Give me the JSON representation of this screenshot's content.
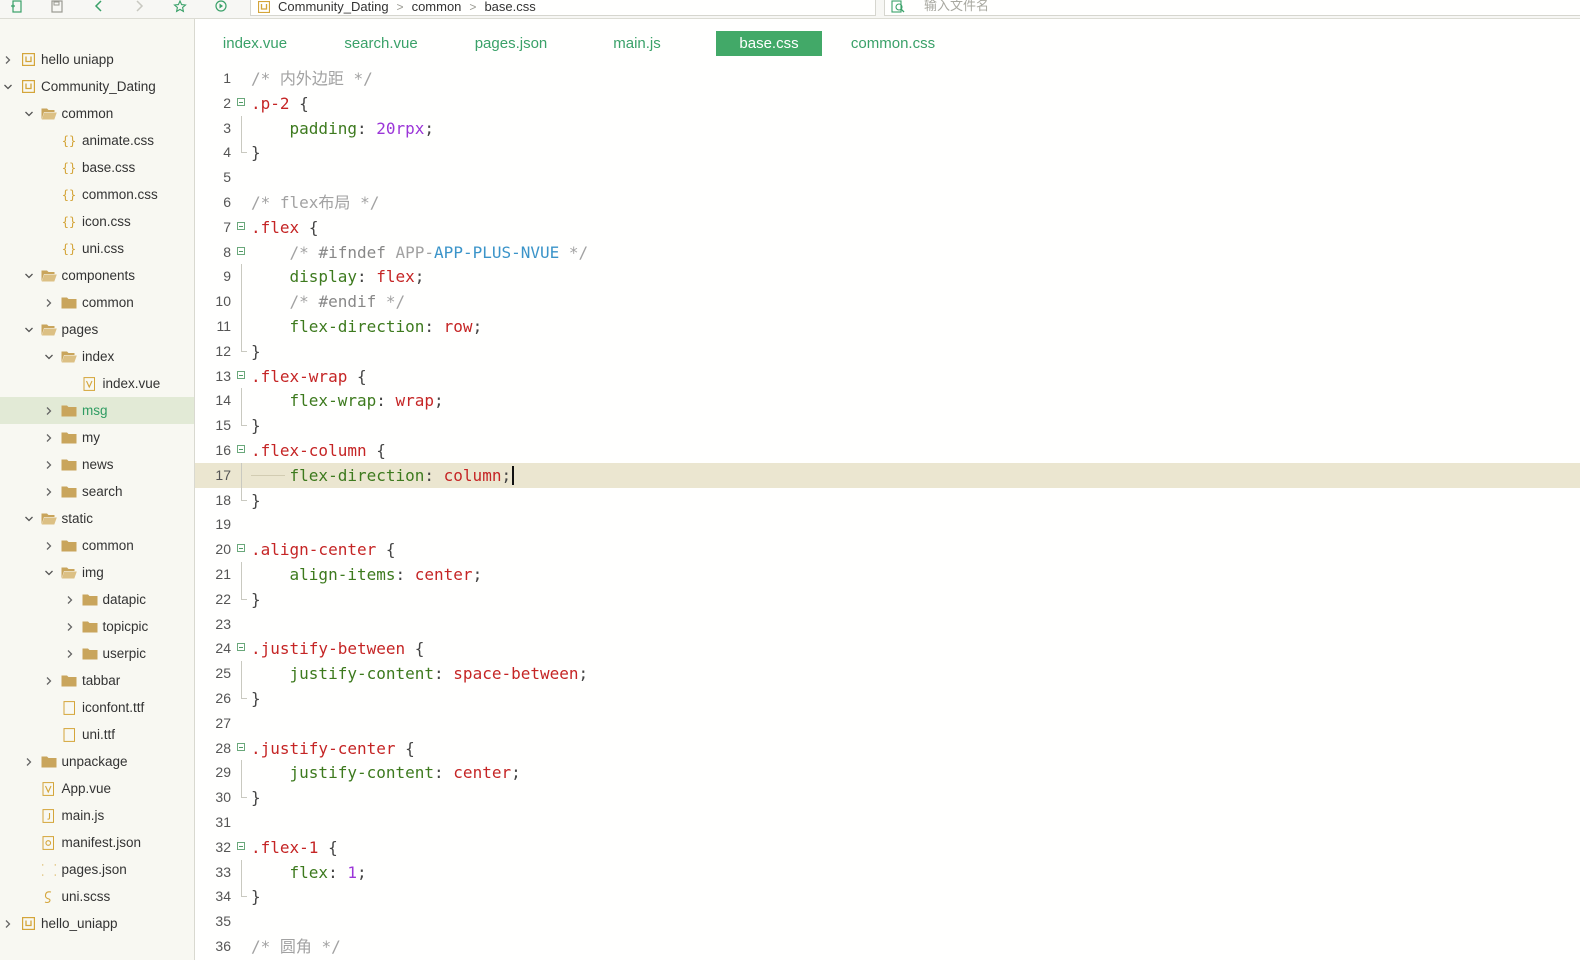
{
  "toolbar": {
    "icons": [
      "new-file-icon",
      "save-icon",
      "back-icon",
      "forward-icon",
      "star-icon",
      "run-icon"
    ]
  },
  "breadcrumb": {
    "items": [
      "Community_Dating",
      "common",
      "base.css"
    ],
    "separator": ">"
  },
  "file_search": {
    "placeholder": "输入文件名"
  },
  "sidebar": {
    "items": [
      {
        "label": "hello uniapp",
        "type": "project",
        "expanded": false
      },
      {
        "label": "Community_Dating",
        "type": "project",
        "expanded": true
      },
      {
        "label": "common",
        "type": "folder",
        "expanded": true
      },
      {
        "label": "animate.css",
        "type": "css-file"
      },
      {
        "label": "base.css",
        "type": "css-file"
      },
      {
        "label": "common.css",
        "type": "css-file"
      },
      {
        "label": "icon.css",
        "type": "css-file"
      },
      {
        "label": "uni.css",
        "type": "css-file"
      },
      {
        "label": "components",
        "type": "folder",
        "expanded": true
      },
      {
        "label": "common",
        "type": "folder",
        "expanded": false
      },
      {
        "label": "pages",
        "type": "folder",
        "expanded": true
      },
      {
        "label": "index",
        "type": "folder",
        "expanded": true
      },
      {
        "label": "index.vue",
        "type": "vue-file"
      },
      {
        "label": "msg",
        "type": "folder",
        "expanded": false,
        "selected": true
      },
      {
        "label": "my",
        "type": "folder",
        "expanded": false
      },
      {
        "label": "news",
        "type": "folder",
        "expanded": false
      },
      {
        "label": "search",
        "type": "folder",
        "expanded": false
      },
      {
        "label": "static",
        "type": "folder",
        "expanded": true
      },
      {
        "label": "common",
        "type": "folder",
        "expanded": false
      },
      {
        "label": "img",
        "type": "folder",
        "expanded": true
      },
      {
        "label": "datapic",
        "type": "folder",
        "expanded": false
      },
      {
        "label": "topicpic",
        "type": "folder",
        "expanded": false
      },
      {
        "label": "userpic",
        "type": "folder",
        "expanded": false
      },
      {
        "label": "tabbar",
        "type": "folder",
        "expanded": false
      },
      {
        "label": "iconfont.ttf",
        "type": "file"
      },
      {
        "label": "uni.ttf",
        "type": "file"
      },
      {
        "label": "unpackage",
        "type": "folder",
        "expanded": false
      },
      {
        "label": "App.vue",
        "type": "vue-file"
      },
      {
        "label": "main.js",
        "type": "js-file"
      },
      {
        "label": "manifest.json",
        "type": "manifest-file"
      },
      {
        "label": "pages.json",
        "type": "json-file"
      },
      {
        "label": "uni.scss",
        "type": "scss-file"
      },
      {
        "label": "hello_uniapp",
        "type": "project",
        "expanded": false
      }
    ]
  },
  "tabs": [
    {
      "label": "index.vue",
      "active": false
    },
    {
      "label": "search.vue",
      "active": false
    },
    {
      "label": "pages.json",
      "active": false
    },
    {
      "label": "main.js",
      "active": false
    },
    {
      "label": "base.css",
      "active": true
    },
    {
      "label": "common.css",
      "active": false
    }
  ],
  "editor": {
    "current_line": 17,
    "lines": [
      {
        "n": "1",
        "tokens": [
          [
            "comment",
            "/* 内外边距 */"
          ]
        ]
      },
      {
        "n": "2",
        "fold": "start",
        "tokens": [
          [
            "selector",
            ".p-2"
          ],
          [
            "space",
            " "
          ],
          [
            "brace",
            "{"
          ]
        ]
      },
      {
        "n": "3",
        "fold": "body",
        "tokens": [
          [
            "space",
            "    "
          ],
          [
            "prop",
            "padding"
          ],
          [
            "punct",
            ": "
          ],
          [
            "number",
            "20rpx"
          ],
          [
            "punct",
            ";"
          ]
        ]
      },
      {
        "n": "4",
        "fold": "end",
        "tokens": [
          [
            "brace",
            "}"
          ]
        ]
      },
      {
        "n": "5",
        "tokens": []
      },
      {
        "n": "6",
        "tokens": [
          [
            "comment",
            "/* flex布局 */"
          ]
        ]
      },
      {
        "n": "7",
        "fold": "start",
        "tokens": [
          [
            "selector",
            ".flex"
          ],
          [
            "space",
            " "
          ],
          [
            "brace",
            "{"
          ]
        ]
      },
      {
        "n": "8",
        "fold": "start",
        "tokens": [
          [
            "space",
            "    "
          ],
          [
            "comment",
            "/* "
          ],
          [
            "cdirective",
            "#ifndef"
          ],
          [
            "comment",
            " APP-"
          ],
          [
            "cmacro",
            "APP-PLUS-NVUE"
          ],
          [
            "comment",
            " */"
          ]
        ]
      },
      {
        "n": "9",
        "fold": "body",
        "tokens": [
          [
            "space",
            "    "
          ],
          [
            "prop",
            "display"
          ],
          [
            "punct",
            ": "
          ],
          [
            "value",
            "flex"
          ],
          [
            "punct",
            ";"
          ]
        ]
      },
      {
        "n": "10",
        "fold": "body",
        "tokens": [
          [
            "space",
            "    "
          ],
          [
            "comment",
            "/* "
          ],
          [
            "cdirective",
            "#endif"
          ],
          [
            "comment",
            " */"
          ]
        ]
      },
      {
        "n": "11",
        "fold": "body",
        "tokens": [
          [
            "space",
            "    "
          ],
          [
            "prop",
            "flex-direction"
          ],
          [
            "punct",
            ": "
          ],
          [
            "value",
            "row"
          ],
          [
            "punct",
            ";"
          ]
        ]
      },
      {
        "n": "12",
        "fold": "end",
        "tokens": [
          [
            "brace",
            "}"
          ]
        ]
      },
      {
        "n": "13",
        "fold": "start",
        "tokens": [
          [
            "selector",
            ".flex-wrap"
          ],
          [
            "space",
            " "
          ],
          [
            "brace",
            "{"
          ]
        ]
      },
      {
        "n": "14",
        "fold": "body",
        "tokens": [
          [
            "space",
            "    "
          ],
          [
            "prop",
            "flex-wrap"
          ],
          [
            "punct",
            ": "
          ],
          [
            "value",
            "wrap"
          ],
          [
            "punct",
            ";"
          ]
        ]
      },
      {
        "n": "15",
        "fold": "end",
        "tokens": [
          [
            "brace",
            "}"
          ]
        ]
      },
      {
        "n": "16",
        "fold": "start",
        "tokens": [
          [
            "selector",
            ".flex-column"
          ],
          [
            "space",
            " "
          ],
          [
            "brace",
            "{"
          ]
        ]
      },
      {
        "n": "17",
        "fold": "body",
        "tokens": [
          [
            "space",
            "    "
          ],
          [
            "prop",
            "flex-direction"
          ],
          [
            "punct",
            ": "
          ],
          [
            "value",
            "column"
          ],
          [
            "punct",
            ";"
          ]
        ]
      },
      {
        "n": "18",
        "fold": "end",
        "tokens": [
          [
            "brace",
            "}"
          ]
        ]
      },
      {
        "n": "19",
        "tokens": []
      },
      {
        "n": "20",
        "fold": "start",
        "tokens": [
          [
            "selector",
            ".align-center"
          ],
          [
            "space",
            " "
          ],
          [
            "brace",
            "{"
          ]
        ]
      },
      {
        "n": "21",
        "fold": "body",
        "tokens": [
          [
            "space",
            "    "
          ],
          [
            "prop",
            "align-items"
          ],
          [
            "punct",
            ": "
          ],
          [
            "value",
            "center"
          ],
          [
            "punct",
            ";"
          ]
        ]
      },
      {
        "n": "22",
        "fold": "end",
        "tokens": [
          [
            "brace",
            "}"
          ]
        ]
      },
      {
        "n": "23",
        "tokens": []
      },
      {
        "n": "24",
        "fold": "start",
        "tokens": [
          [
            "selector",
            ".justify-between"
          ],
          [
            "space",
            " "
          ],
          [
            "brace",
            "{"
          ]
        ]
      },
      {
        "n": "25",
        "fold": "body",
        "tokens": [
          [
            "space",
            "    "
          ],
          [
            "prop",
            "justify-content"
          ],
          [
            "punct",
            ": "
          ],
          [
            "value",
            "space-between"
          ],
          [
            "punct",
            ";"
          ]
        ]
      },
      {
        "n": "26",
        "fold": "end",
        "tokens": [
          [
            "brace",
            "}"
          ]
        ]
      },
      {
        "n": "27",
        "tokens": []
      },
      {
        "n": "28",
        "fold": "start",
        "tokens": [
          [
            "selector",
            ".justify-center"
          ],
          [
            "space",
            " "
          ],
          [
            "brace",
            "{"
          ]
        ]
      },
      {
        "n": "29",
        "fold": "body",
        "tokens": [
          [
            "space",
            "    "
          ],
          [
            "prop",
            "justify-content"
          ],
          [
            "punct",
            ": "
          ],
          [
            "value",
            "center"
          ],
          [
            "punct",
            ";"
          ]
        ]
      },
      {
        "n": "30",
        "fold": "end",
        "tokens": [
          [
            "brace",
            "}"
          ]
        ]
      },
      {
        "n": "31",
        "tokens": []
      },
      {
        "n": "32",
        "fold": "start",
        "tokens": [
          [
            "selector",
            ".flex-1"
          ],
          [
            "space",
            " "
          ],
          [
            "brace",
            "{"
          ]
        ]
      },
      {
        "n": "33",
        "fold": "body",
        "tokens": [
          [
            "space",
            "    "
          ],
          [
            "prop",
            "flex"
          ],
          [
            "punct",
            ": "
          ],
          [
            "number",
            "1"
          ],
          [
            "punct",
            ";"
          ]
        ]
      },
      {
        "n": "34",
        "fold": "end",
        "tokens": [
          [
            "brace",
            "}"
          ]
        ]
      },
      {
        "n": "35",
        "tokens": []
      },
      {
        "n": "36",
        "tokens": [
          [
            "comment",
            "/* 圆角 */"
          ]
        ]
      }
    ]
  },
  "colors": {
    "accent": "#42a968",
    "tab_text": "#3aa169",
    "selection_row": "#e2ead6",
    "current_line": "#ebe6d0",
    "sidebar_bg": "#f8f8f2"
  }
}
